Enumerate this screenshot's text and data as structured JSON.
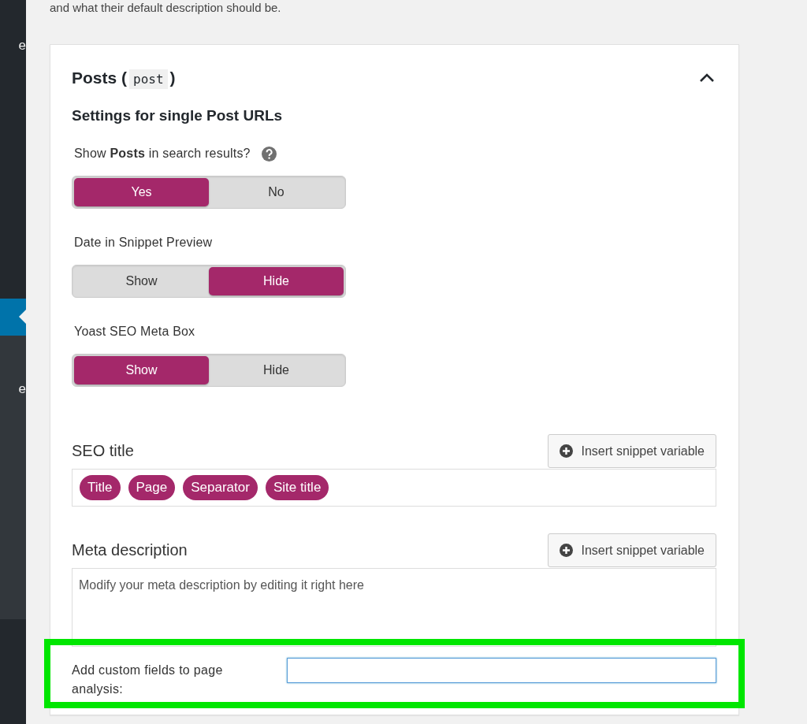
{
  "sidebar": {
    "items": [
      {
        "label": "e",
        "selected": false
      },
      {
        "selected": true
      },
      {
        "label": "e",
        "selected": false
      }
    ]
  },
  "intro": "and what their default description should be.",
  "section": {
    "title": "Posts (",
    "code": "post",
    "title_end": ")",
    "expanded": true,
    "subtitle": "Settings for single Post URLs",
    "toggles": [
      {
        "label": "Show **Posts** in search results?",
        "help": true,
        "options": [
          {
            "label": "Yes",
            "selected": true
          },
          {
            "label": "No",
            "selected": false
          }
        ]
      },
      {
        "label": "Date in Snippet Preview",
        "help": false,
        "options": [
          {
            "label": "Show",
            "selected": false
          },
          {
            "label": "Hide",
            "selected": true
          }
        ]
      },
      {
        "label": "Yoast SEO Meta Box",
        "help": false,
        "options": [
          {
            "label": "Show",
            "selected": true
          },
          {
            "label": "Hide",
            "selected": false
          }
        ]
      }
    ],
    "seo_title": {
      "label": "SEO title",
      "button": "Insert snippet variable",
      "tags": [
        "Title",
        "Page",
        "Separator",
        "Site title"
      ]
    },
    "meta_description": {
      "label": "Meta description",
      "button": "Insert snippet variable",
      "placeholder": "Modify your meta description by editing it right here"
    },
    "custom_fields": {
      "label": "Add custom fields to page analysis:",
      "focused": true,
      "highlighted": true
    }
  }
}
